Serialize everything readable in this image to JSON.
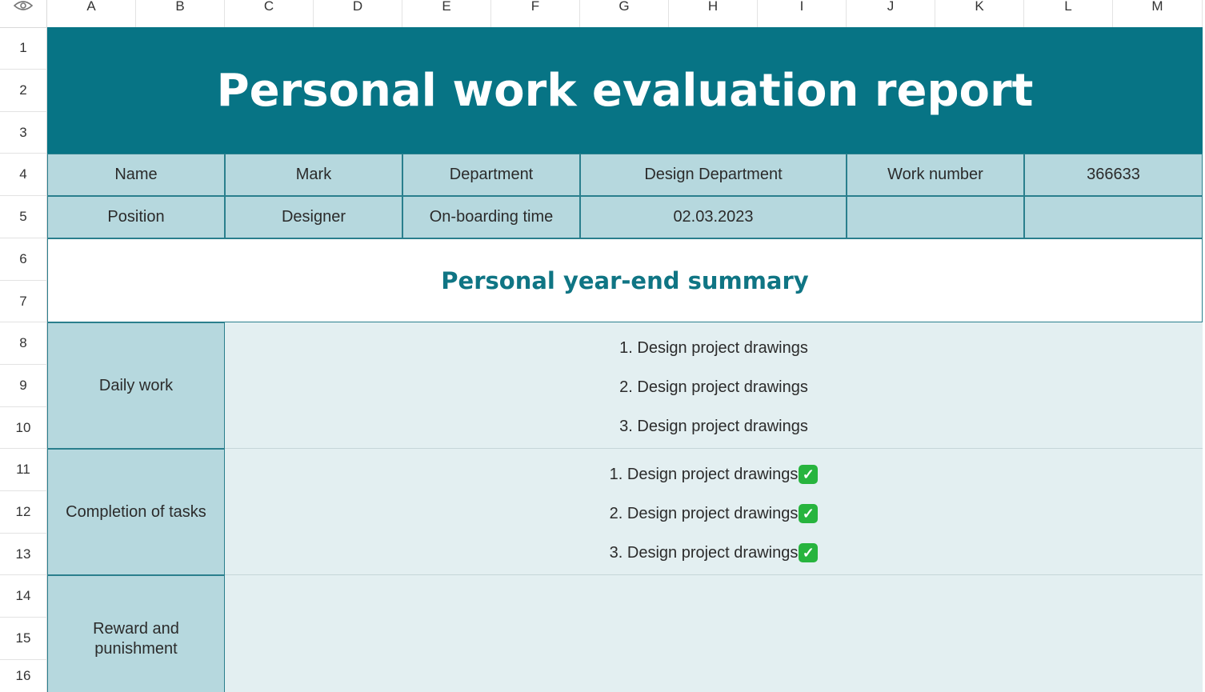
{
  "columns": [
    "A",
    "B",
    "C",
    "D",
    "E",
    "F",
    "G",
    "H",
    "I",
    "J",
    "K",
    "L",
    "M"
  ],
  "rows": [
    "1",
    "2",
    "3",
    "4",
    "5",
    "6",
    "7",
    "8",
    "9",
    "10",
    "11",
    "12",
    "13",
    "14",
    "15",
    "16"
  ],
  "corner_icon": "eye-icon",
  "report": {
    "title": "Personal work evaluation report",
    "info": {
      "name_label": "Name",
      "name_value": "Mark",
      "department_label": "Department",
      "department_value": "Design Department",
      "work_number_label": "Work number",
      "work_number_value": "366633",
      "position_label": "Position",
      "position_value": "Designer",
      "onboarding_label": "On-boarding time",
      "onboarding_value": "02.03.2023",
      "blank1": "",
      "blank2": ""
    },
    "summary_title": "Personal year-end summary",
    "sections": {
      "daily_work": {
        "label": "Daily work",
        "items": [
          "1. Design project drawings",
          "2. Design project drawings",
          "3. Design project drawings"
        ]
      },
      "completion": {
        "label": "Completion of tasks",
        "items": [
          "1. Design project drawings",
          "2. Design project drawings",
          "3. Design project drawings"
        ],
        "check_icon": "check-mark-icon",
        "check_color": "#27b43e"
      },
      "reward": {
        "label": "Reward and punishment"
      }
    }
  },
  "colors": {
    "title_bg": "#077485",
    "info_bg": "#b6d8de",
    "content_bg": "#e3eff1",
    "border": "#2a7f8d",
    "summary_text": "#0f7584"
  }
}
